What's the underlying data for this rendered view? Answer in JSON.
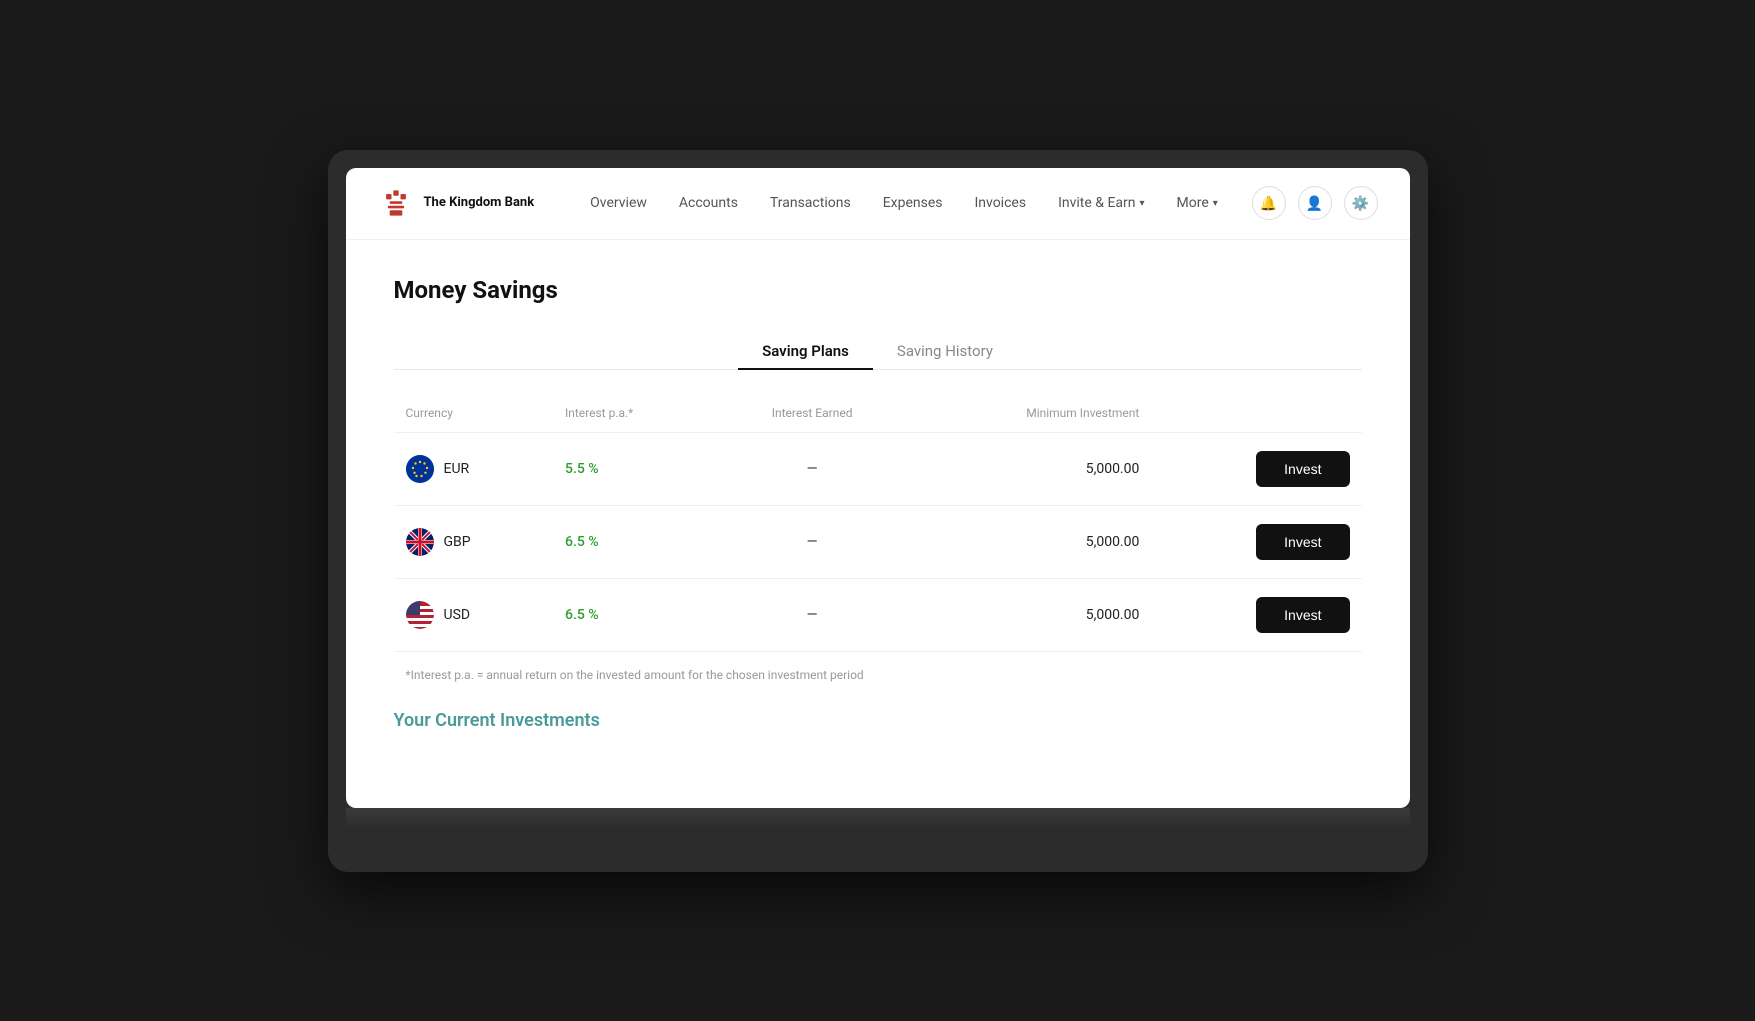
{
  "app": {
    "name": "The Kingdom Bank",
    "logo_alt": "The Kingdom Bank logo"
  },
  "nav": {
    "links": [
      {
        "id": "overview",
        "label": "Overview"
      },
      {
        "id": "accounts",
        "label": "Accounts"
      },
      {
        "id": "transactions",
        "label": "Transactions"
      },
      {
        "id": "expenses",
        "label": "Expenses"
      },
      {
        "id": "invoices",
        "label": "Invoices"
      },
      {
        "id": "invite-earn",
        "label": "Invite & Earn",
        "has_dropdown": true
      },
      {
        "id": "more",
        "label": "More",
        "has_dropdown": true
      }
    ]
  },
  "page": {
    "title": "Money Savings"
  },
  "tabs": [
    {
      "id": "saving-plans",
      "label": "Saving Plans",
      "active": true
    },
    {
      "id": "saving-history",
      "label": "Saving History",
      "active": false
    }
  ],
  "table": {
    "headers": [
      "Currency",
      "Interest p.a.*",
      "Interest Earned",
      "Minimum Investment",
      ""
    ],
    "rows": [
      {
        "currency_code": "EUR",
        "currency_name": "EUR",
        "flag_type": "eur",
        "interest_rate": "5.5 %",
        "interest_earned": "—",
        "min_investment": "5,000.00",
        "button_label": "Invest"
      },
      {
        "currency_code": "GBP",
        "currency_name": "GBP",
        "flag_type": "gbp",
        "interest_rate": "6.5 %",
        "interest_earned": "—",
        "min_investment": "5,000.00",
        "button_label": "Invest"
      },
      {
        "currency_code": "USD",
        "currency_name": "USD",
        "flag_type": "usd",
        "interest_rate": "6.5 %",
        "interest_earned": "—",
        "min_investment": "5,000.00",
        "button_label": "Invest"
      }
    ],
    "footnote": "*Interest p.a. = annual return on the invested amount for the chosen investment period"
  },
  "current_investments": {
    "title": "Your Current Investments"
  }
}
